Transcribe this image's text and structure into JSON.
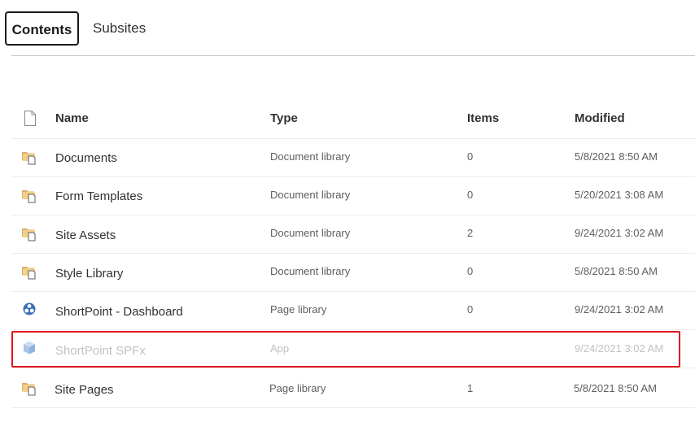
{
  "tabs": [
    {
      "label": "Contents",
      "active": true
    },
    {
      "label": "Subsites",
      "active": false
    }
  ],
  "table": {
    "headers": {
      "name": "Name",
      "type": "Type",
      "items": "Items",
      "modified": "Modified"
    },
    "rows": [
      {
        "icon": "library-folder-icon",
        "name": "Documents",
        "type": "Document library",
        "items": "0",
        "modified": "5/8/2021 8:50 AM"
      },
      {
        "icon": "library-folder-icon",
        "name": "Form Templates",
        "type": "Document library",
        "items": "0",
        "modified": "5/20/2021 3:08 AM"
      },
      {
        "icon": "library-folder-icon",
        "name": "Site Assets",
        "type": "Document library",
        "items": "2",
        "modified": "9/24/2021 3:02 AM"
      },
      {
        "icon": "library-folder-icon",
        "name": "Style Library",
        "type": "Document library",
        "items": "0",
        "modified": "5/8/2021 8:50 AM"
      },
      {
        "icon": "shortpoint-app-icon",
        "name": "ShortPoint - Dashboard",
        "type": "Page library",
        "items": "0",
        "modified": "9/24/2021 3:02 AM"
      },
      {
        "icon": "app-cube-icon",
        "name": "ShortPoint SPFx",
        "type": "App",
        "items": "",
        "modified": "9/24/2021 3:02 AM",
        "dimmed": true,
        "highlighted": true
      },
      {
        "icon": "library-folder-icon",
        "name": "Site Pages",
        "type": "Page library",
        "items": "1",
        "modified": "5/8/2021 8:50 AM"
      }
    ]
  },
  "colors": {
    "highlight_border": "#e0141e",
    "folder_fill": "#e8b86b",
    "shortpoint_blue": "#3a7bd5"
  }
}
